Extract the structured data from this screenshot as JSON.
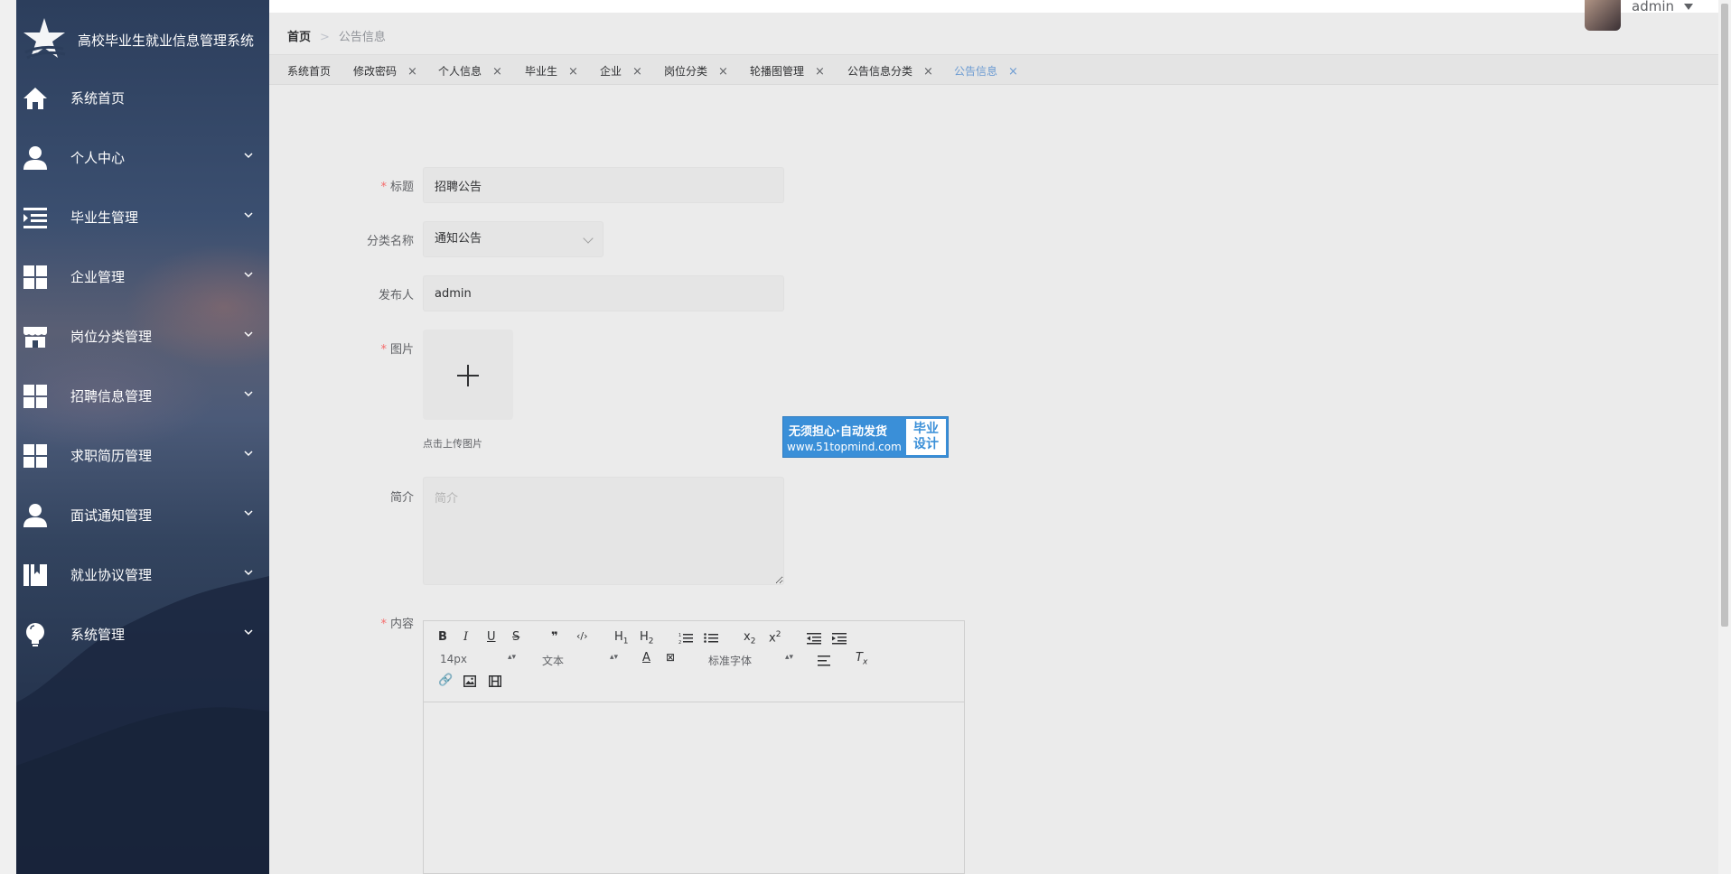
{
  "app": {
    "title": "高校毕业生就业信息管理系统"
  },
  "sidebar": {
    "items": [
      {
        "label": "系统首页",
        "icon": "home-icon"
      },
      {
        "label": "个人中心",
        "icon": "person-icon"
      },
      {
        "label": "毕业生管理",
        "icon": "list-indent-icon"
      },
      {
        "label": "企业管理",
        "icon": "grid-icon"
      },
      {
        "label": "岗位分类管理",
        "icon": "store-icon"
      },
      {
        "label": "招聘信息管理",
        "icon": "grid-icon"
      },
      {
        "label": "求职简历管理",
        "icon": "grid-icon"
      },
      {
        "label": "面试通知管理",
        "icon": "person-icon"
      },
      {
        "label": "就业协议管理",
        "icon": "book-icon"
      },
      {
        "label": "系统管理",
        "icon": "bulb-icon"
      }
    ]
  },
  "header": {
    "breadcrumb_home": "首页",
    "breadcrumb_sep": ">",
    "breadcrumb_current": "公告信息",
    "username": "admin"
  },
  "tabs": [
    {
      "label": "系统首页",
      "closable": false
    },
    {
      "label": "修改密码",
      "closable": true
    },
    {
      "label": "个人信息",
      "closable": true
    },
    {
      "label": "毕业生",
      "closable": true
    },
    {
      "label": "企业",
      "closable": true
    },
    {
      "label": "岗位分类",
      "closable": true
    },
    {
      "label": "轮播图管理",
      "closable": true
    },
    {
      "label": "公告信息分类",
      "closable": true
    },
    {
      "label": "公告信息",
      "closable": true,
      "active": true
    }
  ],
  "tab_close_glyph": "×",
  "form": {
    "title_label": "标题",
    "title_value": "招聘公告",
    "category_label": "分类名称",
    "category_value": "通知公告",
    "publisher_label": "发布人",
    "publisher_value": "admin",
    "image_label": "图片",
    "upload_tip": "点击上传图片",
    "intro_label": "简介",
    "intro_placeholder": "简介",
    "content_label": "内容",
    "required_mark": "*"
  },
  "editor": {
    "font_size": "14px",
    "header_select": "文本",
    "font_family": "标准字体",
    "buttons": [
      "bold",
      "italic",
      "underline",
      "strike",
      "blockquote",
      "code-block",
      "h1",
      "h2",
      "ordered-list",
      "bullet-list",
      "subscript",
      "superscript",
      "outdent",
      "indent",
      "color",
      "background",
      "align",
      "clean",
      "link",
      "image",
      "video"
    ]
  },
  "watermark": {
    "line1": "无须担心·自动发货",
    "line2": "www.51topmind.com",
    "right_line1": "毕业",
    "right_line2": "设计"
  },
  "colors": {
    "accent": "#6c9bd2",
    "required": "#f56c6c",
    "watermark": "#3a8fd8"
  }
}
